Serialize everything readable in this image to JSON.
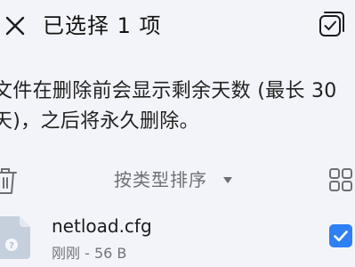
{
  "topbar": {
    "title": "已选择 1 项",
    "close_icon": "close-icon",
    "select_all_icon": "select-all-icon"
  },
  "info": {
    "line1": "文件在删除前会显示剩余天数 (最长 30",
    "line2": "天)，之后将永久删除。"
  },
  "sortbar": {
    "label": "按类型排序",
    "caret_icon": "caret-down-icon",
    "trash_icon": "trash-icon",
    "view_icon": "grid-view-icon"
  },
  "file": {
    "name": "netload.cfg",
    "meta": "刚刚 - 56 B",
    "selected": true,
    "file_icon": "unknown-file-icon"
  },
  "colors": {
    "background": "#f3f4f9",
    "accent": "#2f80f5",
    "secondary_text": "#6e6f74"
  }
}
